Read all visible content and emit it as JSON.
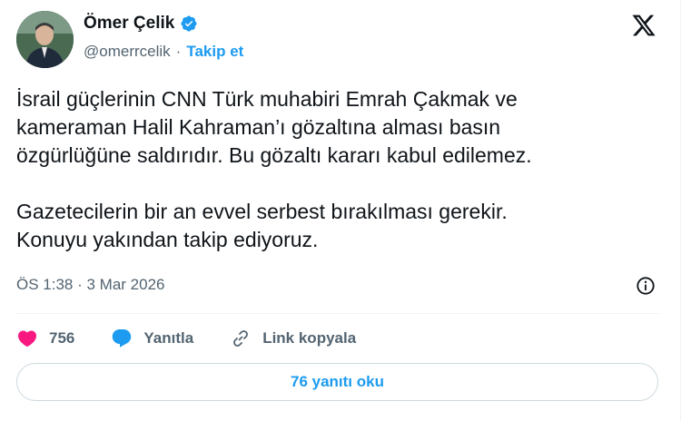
{
  "author": {
    "name": "Ömer Çelik",
    "handle": "@omerrcelik",
    "separator": "·",
    "follow_label": "Takip et"
  },
  "tweet": {
    "text": "İsrail güçlerinin CNN Türk muhabiri Emrah Çakmak ve\nkameraman Halil Kahraman’ı gözaltına alması basın\nözgürlüğüne saldırıdır. Bu gözaltı kararı kabul edilemez.\n\nGazetecilerin bir an evvel serbest bırakılması gerekir.\nKonuyu yakından takip ediyoruz.",
    "timestamp": "ÖS 1:38 · 3 Mar 2026"
  },
  "actions": {
    "like_count": "756",
    "reply_label": "Yanıtla",
    "copy_link_label": "Link kopyala"
  },
  "replies_button_label": "76 yanıtı oku",
  "colors": {
    "accent": "#1d9bf0",
    "like": "#f91880",
    "text": "#0f1419",
    "muted": "#536471"
  },
  "icons": {
    "verified": "verified-badge-icon",
    "platform": "x-logo-icon",
    "info": "info-icon",
    "like": "heart-icon",
    "reply": "reply-bubble-icon",
    "link": "link-icon"
  }
}
